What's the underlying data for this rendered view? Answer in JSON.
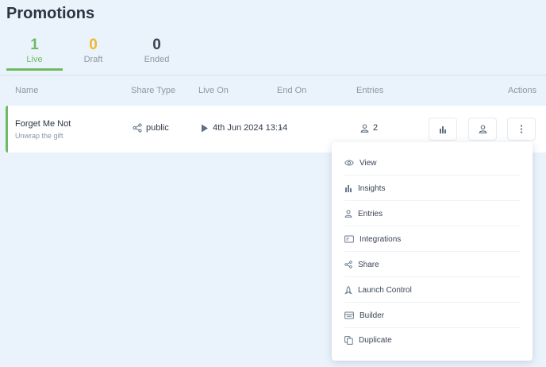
{
  "page": {
    "title": "Promotions"
  },
  "stats": [
    {
      "count": "1",
      "label": "Live",
      "color": "#6fba62"
    },
    {
      "count": "0",
      "label": "Draft",
      "color": "#f2b632"
    },
    {
      "count": "0",
      "label": "Ended",
      "color": "#3a4554"
    }
  ],
  "table": {
    "headers": {
      "name": "Name",
      "share_type": "Share Type",
      "live_on": "Live On",
      "end_on": "End On",
      "entries": "Entries",
      "actions": "Actions"
    },
    "rows": [
      {
        "name": "Forget Me Not",
        "subtitle": "Unwrap the gift",
        "share_type": "public",
        "live_on": "4th Jun 2024 13:14",
        "end_on": "-",
        "entries": "2"
      }
    ]
  },
  "actions_menu": {
    "items": [
      {
        "label": "View",
        "icon": "eye-icon"
      },
      {
        "label": "Insights",
        "icon": "bar-chart-icon"
      },
      {
        "label": "Entries",
        "icon": "user-icon"
      },
      {
        "label": "Integrations",
        "icon": "integrations-icon"
      },
      {
        "label": "Share",
        "icon": "share-icon"
      },
      {
        "label": "Launch Control",
        "icon": "rocket-icon"
      },
      {
        "label": "Builder",
        "icon": "builder-icon"
      },
      {
        "label": "Duplicate",
        "icon": "duplicate-icon"
      }
    ]
  },
  "colors": {
    "accent": "#6fba62",
    "draft": "#f2b632",
    "background": "#eaf3fb",
    "muted_text": "#8b97a6",
    "icon": "#6b7a90"
  }
}
